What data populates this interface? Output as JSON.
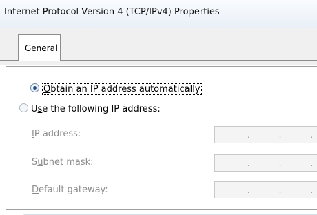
{
  "window": {
    "title": "Internet Protocol Version 4 (TCP/IPv4) Properties"
  },
  "tabs": [
    {
      "label": "General",
      "selected": true
    }
  ],
  "options": {
    "obtain_auto": {
      "mnemonic": "O",
      "rest": "btain an IP address automatically",
      "checked": true
    },
    "use_following": {
      "prefix": "U",
      "mnemonic": "s",
      "rest": "e the following IP address:",
      "checked": false
    }
  },
  "fields": [
    {
      "key": "ip_address",
      "prefix": "",
      "mnemonic": "I",
      "rest": "P address:",
      "value": ". . ."
    },
    {
      "key": "subnet_mask",
      "prefix": "S",
      "mnemonic": "u",
      "rest": "bnet mask:",
      "value": ". . ."
    },
    {
      "key": "default_gateway",
      "prefix": "",
      "mnemonic": "D",
      "rest": "efault gateway:",
      "value": ". . ."
    }
  ],
  "colors": {
    "title_bg": "#eaf0f8",
    "disabled_text": "#8d8d8d",
    "radio_dot": "#1f4f8f"
  }
}
